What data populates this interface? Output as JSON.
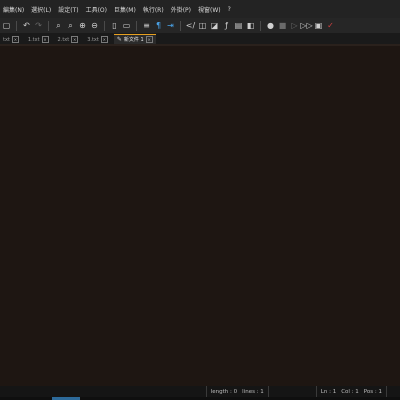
{
  "menu": [
    "編集(N)",
    "選択(L)",
    "設定(T)",
    "工具(O)",
    "巨集(M)",
    "執行(R)",
    "外掛(P)",
    "視窗(W)",
    "?"
  ],
  "toolbar": [
    {
      "name": "new-file-icon",
      "glyph": "▢",
      "tone": "normal"
    },
    {
      "name": "undo-icon",
      "glyph": "↶",
      "tone": "normal"
    },
    {
      "name": "redo-icon",
      "glyph": "↷",
      "tone": "dim"
    },
    {
      "name": "find-icon",
      "glyph": "⌕",
      "tone": "normal"
    },
    {
      "name": "replace-icon",
      "glyph": "⌕",
      "tone": "normal"
    },
    {
      "name": "zoom-in-icon",
      "glyph": "⊕",
      "tone": "normal"
    },
    {
      "name": "zoom-out-icon",
      "glyph": "⊖",
      "tone": "normal"
    },
    {
      "name": "sync-v-icon",
      "glyph": "▯",
      "tone": "normal"
    },
    {
      "name": "sync-h-icon",
      "glyph": "▭",
      "tone": "normal"
    },
    {
      "name": "word-wrap-icon",
      "glyph": "≡",
      "tone": "normal"
    },
    {
      "name": "show-all-chars-icon",
      "glyph": "¶",
      "tone": "blue"
    },
    {
      "name": "indent-guide-icon",
      "glyph": "⇥",
      "tone": "blue"
    },
    {
      "name": "udl-icon",
      "glyph": "</",
      "tone": "normal"
    },
    {
      "name": "doc-map-icon",
      "glyph": "◫",
      "tone": "normal"
    },
    {
      "name": "doc-list-icon",
      "glyph": "◪",
      "tone": "normal"
    },
    {
      "name": "function-list-icon",
      "glyph": "ƒ",
      "tone": "normal"
    },
    {
      "name": "folder-workspace-icon",
      "glyph": "▤",
      "tone": "normal"
    },
    {
      "name": "monitoring-icon",
      "glyph": "◧",
      "tone": "normal"
    },
    {
      "name": "record-macro-icon",
      "glyph": "●",
      "tone": "normal"
    },
    {
      "name": "stop-macro-icon",
      "glyph": "■",
      "tone": "dim"
    },
    {
      "name": "play-macro-icon",
      "glyph": "▷",
      "tone": "dim"
    },
    {
      "name": "play-multiple-icon",
      "glyph": "▷▷",
      "tone": "normal"
    },
    {
      "name": "save-macro-icon",
      "glyph": "▣",
      "tone": "normal"
    },
    {
      "name": "spell-check-icon",
      "glyph": "✓",
      "tone": "red"
    }
  ],
  "tabs": [
    {
      "label": "txt",
      "active": false
    },
    {
      "label": "1.txt",
      "active": false
    },
    {
      "label": "2.txt",
      "active": false
    },
    {
      "label": "3.txt",
      "active": false
    },
    {
      "label": "新文件 1",
      "active": true
    }
  ],
  "status": {
    "length": "length : 0",
    "lines": "lines : 1",
    "ln": "Ln : 1",
    "col": "Col : 1",
    "pos": "Pos : 1"
  }
}
